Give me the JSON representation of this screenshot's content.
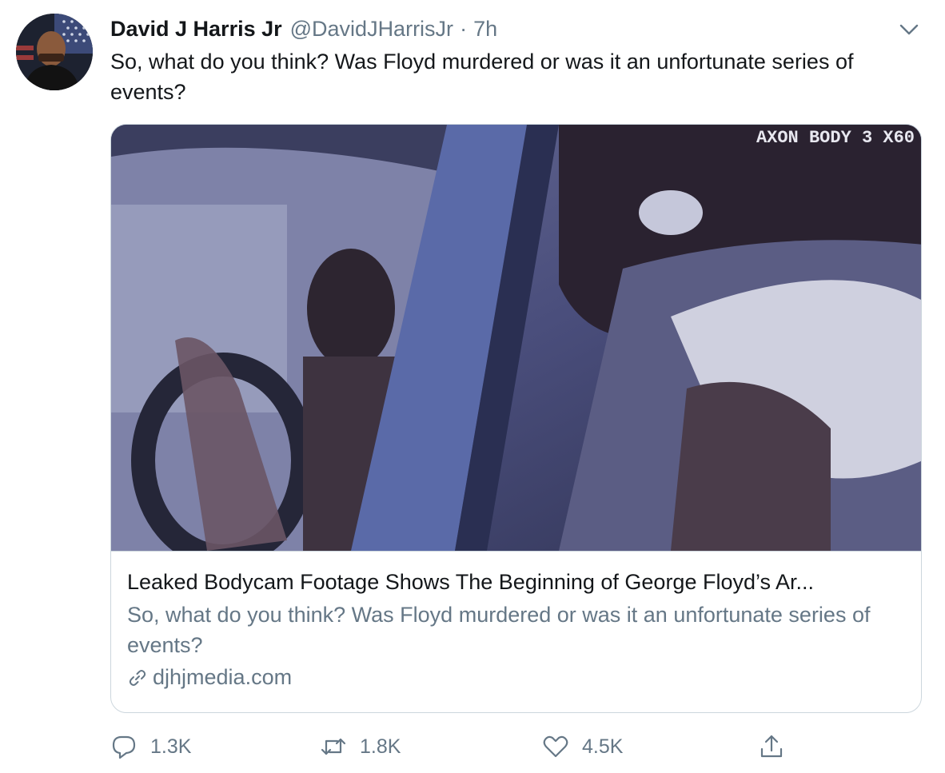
{
  "tweet": {
    "author_name": "David J Harris Jr",
    "handle": "@DavidJHarrisJr",
    "separator": "·",
    "time": "7h",
    "text": "So, what do you think?  Was Floyd murdered or was it an unfortunate series of events?",
    "menu_icon": "chevron-down-icon",
    "avatar_icon": "avatar-photo"
  },
  "card": {
    "image_overlay_text": "AXON BODY 3 X60",
    "title": "Leaked Bodycam Footage Shows The Beginning of George Floyd’s Ar...",
    "description": "So, what do you think? Was Floyd murdered or was it an unfortunate series of events?",
    "domain": "djhjmedia.com",
    "domain_icon": "link-icon"
  },
  "actions": {
    "reply_count": "1.3K",
    "retweet_count": "1.8K",
    "like_count": "4.5K",
    "reply_icon": "reply-icon",
    "retweet_icon": "retweet-icon",
    "like_icon": "heart-icon",
    "share_icon": "share-icon"
  },
  "colors": {
    "text_primary": "#14171a",
    "text_secondary": "#657786",
    "border": "#ccd6dd"
  }
}
